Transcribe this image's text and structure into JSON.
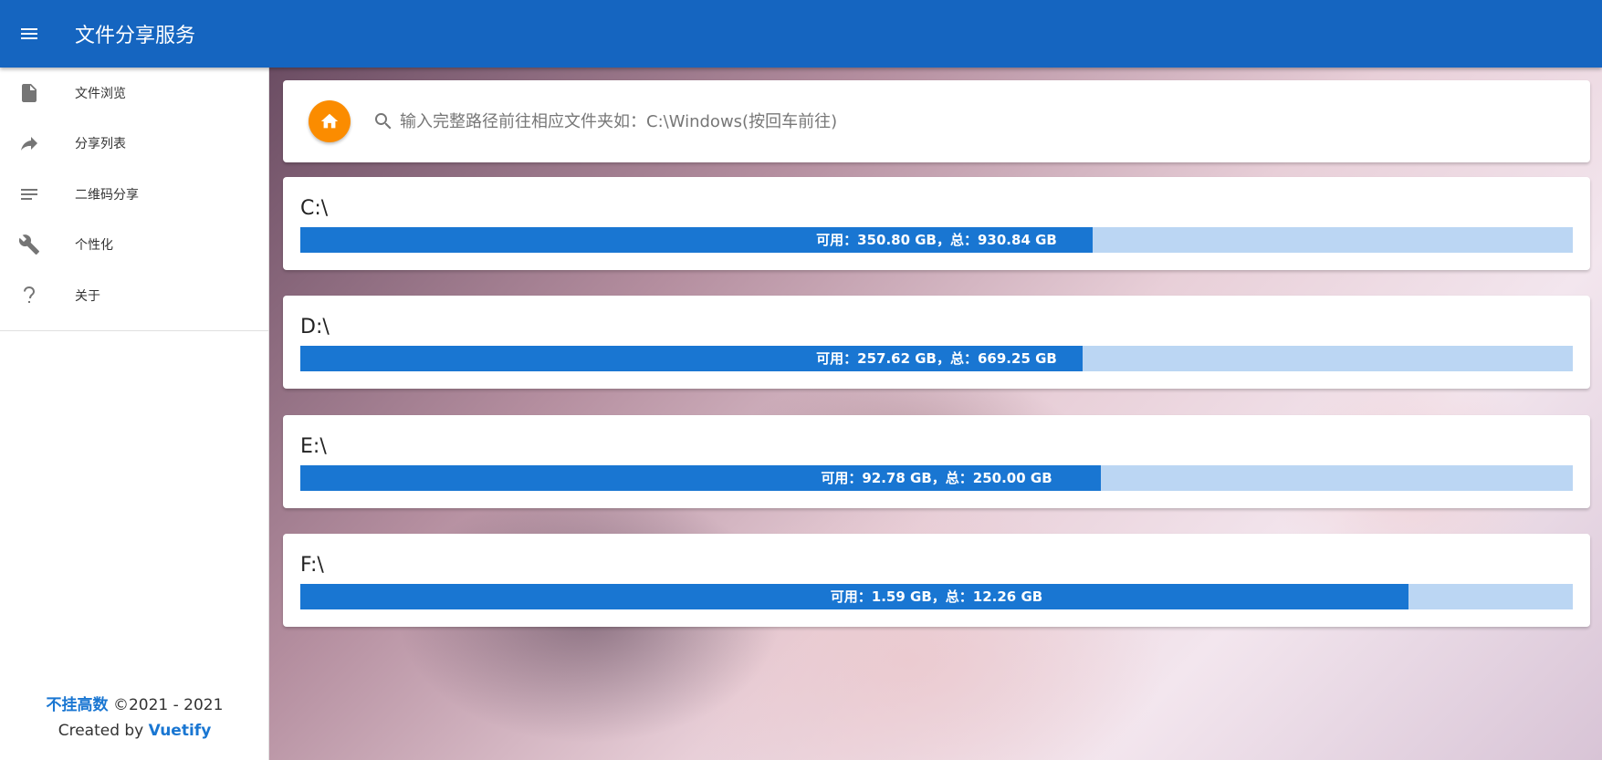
{
  "app": {
    "title": "文件分享服务"
  },
  "icons": {
    "menu": "menu-icon",
    "home": "home-icon",
    "search": "search-icon"
  },
  "colors": {
    "appbar": "#1565c0",
    "bar_fill": "#1976d2",
    "bar_track": "#bbd6f3",
    "home_button": "#fb8c00"
  },
  "sidebar": {
    "items": [
      {
        "label": "文件浏览",
        "icon": "file-icon"
      },
      {
        "label": "分享列表",
        "icon": "share-icon"
      },
      {
        "label": "二维码分享",
        "icon": "list-icon"
      },
      {
        "label": "个性化",
        "icon": "wrench-icon"
      },
      {
        "label": "关于",
        "icon": "help-icon"
      }
    ]
  },
  "footer": {
    "author": "不挂高数",
    "copyright": "©2021 - 2021",
    "created_by": "Created by",
    "framework": "Vuetify"
  },
  "search": {
    "placeholder": "输入完整路径前往相应文件夹如：C:\\Windows(按回车前往)"
  },
  "drives": [
    {
      "name": "C:\\",
      "usage_text": "可用：350.80 GB，总：930.84 GB",
      "fill_percent": 62.3
    },
    {
      "name": "D:\\",
      "usage_text": "可用：257.62 GB，总：669.25 GB",
      "fill_percent": 61.5
    },
    {
      "name": "E:\\",
      "usage_text": "可用：92.78 GB，总：250.00 GB",
      "fill_percent": 62.9
    },
    {
      "name": "F:\\",
      "usage_text": "可用：1.59 GB，总：12.26 GB",
      "fill_percent": 87.1
    }
  ]
}
